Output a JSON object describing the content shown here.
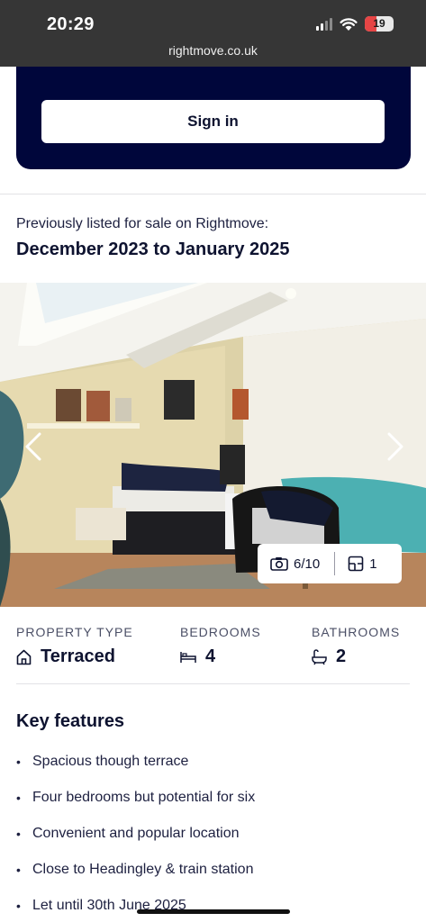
{
  "status_bar": {
    "time": "20:29",
    "battery": "19",
    "url": "rightmove.co.uk",
    "icons": [
      "signal-icon",
      "wifi-icon",
      "battery-icon"
    ]
  },
  "signin": {
    "button_label": "Sign in"
  },
  "listing_history": {
    "label": "Previously listed for sale on Rightmove:",
    "dates": "December 2023 to January 2025"
  },
  "gallery": {
    "photo_counter": "6/10",
    "floorplan_count": "1",
    "icons": [
      "chevron-left-icon",
      "chevron-right-icon",
      "camera-icon",
      "floorplan-icon"
    ]
  },
  "property_details": {
    "type": {
      "label": "PROPERTY TYPE",
      "value": "Terraced",
      "icon": "house-icon"
    },
    "bedrooms": {
      "label": "BEDROOMS",
      "value": "4",
      "icon": "bed-icon"
    },
    "bathrooms": {
      "label": "BATHROOMS",
      "value": "2",
      "icon": "bath-icon"
    }
  },
  "key_features": {
    "title": "Key features",
    "items": [
      "Spacious though terrace",
      "Four bedrooms but potential for six",
      "Convenient and popular location",
      "Close to Headingley & train station",
      "Let until 30th June 2025"
    ]
  },
  "colors": {
    "brand_navy": "#00063b",
    "status_bar": "#363636",
    "battery_low": "#e64545"
  }
}
